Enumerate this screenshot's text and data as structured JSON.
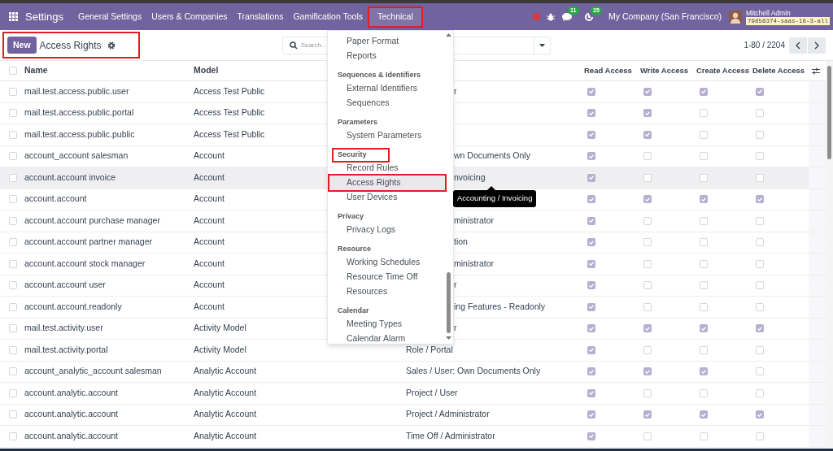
{
  "navbar": {
    "app": "Settings",
    "menus": [
      {
        "label": "General Settings",
        "annotated": false
      },
      {
        "label": "Users & Companies",
        "annotated": false
      },
      {
        "label": "Translations",
        "annotated": false
      },
      {
        "label": "Gamification Tools",
        "annotated": false
      },
      {
        "label": "Technical",
        "annotated": true
      }
    ],
    "notifications": [
      {
        "kind": "messages",
        "count": "11"
      },
      {
        "kind": "activities",
        "count": "25"
      }
    ],
    "company": "My Company (San Francisco)",
    "user": "Mitchell Admin",
    "database": "79856374-saas-18-3-all"
  },
  "control_panel": {
    "new_button": "New",
    "title": "Access Rights",
    "annotated": true,
    "search": {
      "placeholder": "Search.."
    },
    "pager": "1-80 / 2204"
  },
  "table": {
    "all_selected": false,
    "columns": [
      "Name",
      "Model",
      "Read Access",
      "Write Access",
      "Create Access",
      "Delete Access"
    ],
    "rows": [
      {
        "name": "mail.test.access.public.user",
        "model": "Access Test Public",
        "group": "r",
        "read": true,
        "write": true,
        "create": true,
        "delete": true,
        "hovered": false
      },
      {
        "name": "mail.test.access.public.portal",
        "model": "Access Test Public",
        "read": true,
        "write": true,
        "create": false,
        "delete": false,
        "hovered": false
      },
      {
        "name": "mail.test.access.public.public",
        "model": "Access Test Public",
        "read": true,
        "write": true,
        "create": false,
        "delete": false,
        "hovered": false
      },
      {
        "name": "account_account salesman",
        "model": "Account",
        "group": "wn Documents Only",
        "read": true,
        "write": false,
        "create": false,
        "delete": false,
        "hovered": false
      },
      {
        "name": "account.account invoice",
        "model": "Account",
        "group": "nvoicing",
        "read": true,
        "write": false,
        "create": false,
        "delete": false,
        "hovered": true
      },
      {
        "name": "account.account",
        "model": "Account",
        "read": true,
        "write": true,
        "create": true,
        "delete": true,
        "hovered": false
      },
      {
        "name": "account.account purchase manager",
        "model": "Account",
        "group": "ministrator",
        "read": true,
        "write": false,
        "create": false,
        "delete": false,
        "hovered": false
      },
      {
        "name": "account.account partner manager",
        "model": "Account",
        "group": "tion",
        "read": true,
        "write": false,
        "create": false,
        "delete": false,
        "hovered": false
      },
      {
        "name": "account.account stock manager",
        "model": "Account",
        "group": "ministrator",
        "read": true,
        "write": false,
        "create": false,
        "delete": false,
        "hovered": false
      },
      {
        "name": "account.account user",
        "model": "Account",
        "group": "r",
        "read": true,
        "write": false,
        "create": false,
        "delete": false,
        "hovered": false
      },
      {
        "name": "account.account.readonly",
        "model": "Account",
        "group": "ing Features - Readonly",
        "read": true,
        "write": false,
        "create": false,
        "delete": false,
        "hovered": false
      },
      {
        "name": "mail.test.activity.user",
        "model": "Activity Model",
        "group": "r",
        "read": true,
        "write": true,
        "create": true,
        "delete": true,
        "hovered": false
      },
      {
        "name": "mail.test.activity.portal",
        "model": "Activity Model",
        "group": "Role / Portal",
        "read": true,
        "write": false,
        "create": false,
        "delete": false,
        "hovered": false
      },
      {
        "name": "account_analytic_account salesman",
        "model": "Analytic Account",
        "group": "Sales / User: Own Documents Only",
        "read": true,
        "write": true,
        "create": true,
        "delete": false,
        "hovered": false
      },
      {
        "name": "account.analytic.account",
        "model": "Analytic Account",
        "group": "Project / User",
        "read": true,
        "write": false,
        "create": false,
        "delete": false,
        "hovered": false
      },
      {
        "name": "account.analytic.account",
        "model": "Analytic Account",
        "group": "Project / Administrator",
        "read": true,
        "write": true,
        "create": true,
        "delete": true,
        "hovered": false
      },
      {
        "name": "account.analytic.account",
        "model": "Analytic Account",
        "group": "Time Off / Administrator",
        "read": true,
        "write": false,
        "create": false,
        "delete": false,
        "hovered": false
      }
    ]
  },
  "dropdown": {
    "sections": [
      {
        "items": [
          {
            "label": "Paper Format",
            "selected": false,
            "annotated": false
          },
          {
            "label": "Reports",
            "selected": false,
            "annotated": false
          }
        ]
      },
      {
        "header": "Sequences & Identifiers",
        "annotated": false,
        "items": [
          {
            "label": "External Identifiers",
            "selected": false,
            "annotated": false
          },
          {
            "label": "Sequences",
            "selected": false,
            "annotated": false
          }
        ]
      },
      {
        "header": "Parameters",
        "annotated": false,
        "items": [
          {
            "label": "System Parameters",
            "selected": false,
            "annotated": false
          }
        ]
      },
      {
        "header": "Security",
        "annotated": true,
        "items": [
          {
            "label": "Record Rules",
            "selected": false,
            "annotated": false
          },
          {
            "label": "Access Rights",
            "selected": true,
            "annotated": true
          },
          {
            "label": "User Devices",
            "selected": false,
            "annotated": false
          }
        ]
      },
      {
        "header": "Privacy",
        "annotated": false,
        "items": [
          {
            "label": "Privacy Logs",
            "selected": false,
            "annotated": false
          }
        ]
      },
      {
        "header": "Resource",
        "annotated": false,
        "items": [
          {
            "label": "Working Schedules",
            "selected": false,
            "annotated": false
          },
          {
            "label": "Resource Time Off",
            "selected": false,
            "annotated": false
          },
          {
            "label": "Resources",
            "selected": false,
            "annotated": false
          }
        ]
      },
      {
        "header": "Calendar",
        "annotated": false,
        "items": [
          {
            "label": "Meeting Types",
            "selected": false,
            "annotated": false
          },
          {
            "label": "Calendar Alarm",
            "selected": false,
            "annotated": false
          }
        ]
      }
    ]
  },
  "tooltip": "Accounting / Invoicing"
}
